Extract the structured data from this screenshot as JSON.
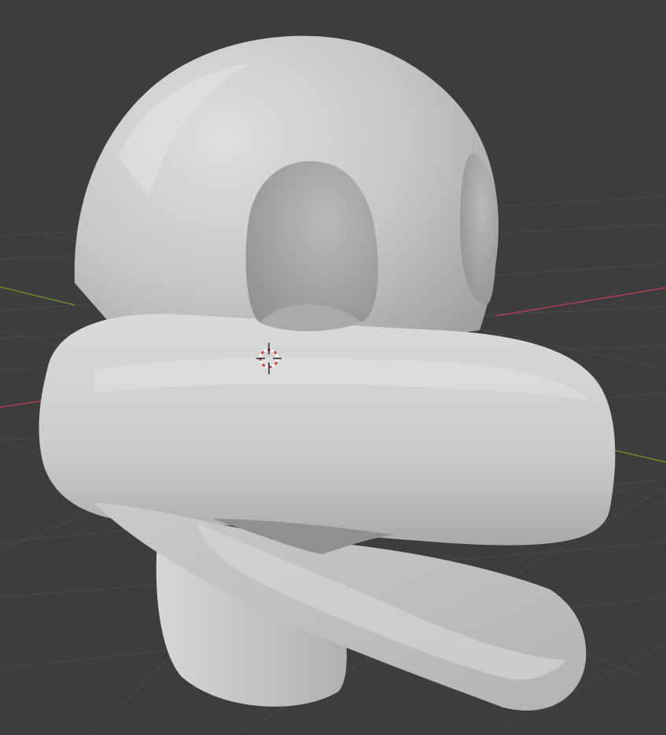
{
  "viewport": {
    "background": "#3d3d3d",
    "grid_color": "#4a4a4a",
    "grid_color_strong": "#555555",
    "x_axis_color": "#c3404f",
    "y_axis_color": "#6a9a2a"
  },
  "object": {
    "kind": "sculpted-head-mesh",
    "base_color": "#c8c9c9",
    "highlight_color": "#e2e3e3",
    "shadow_color": "#8d8e8f",
    "shading": "solid"
  },
  "cursor_3d": {
    "icon": "3d-cursor-icon",
    "ring_color_a": "#d13b3b",
    "ring_color_b": "#ffffff",
    "crosshair_color": "#111111"
  }
}
